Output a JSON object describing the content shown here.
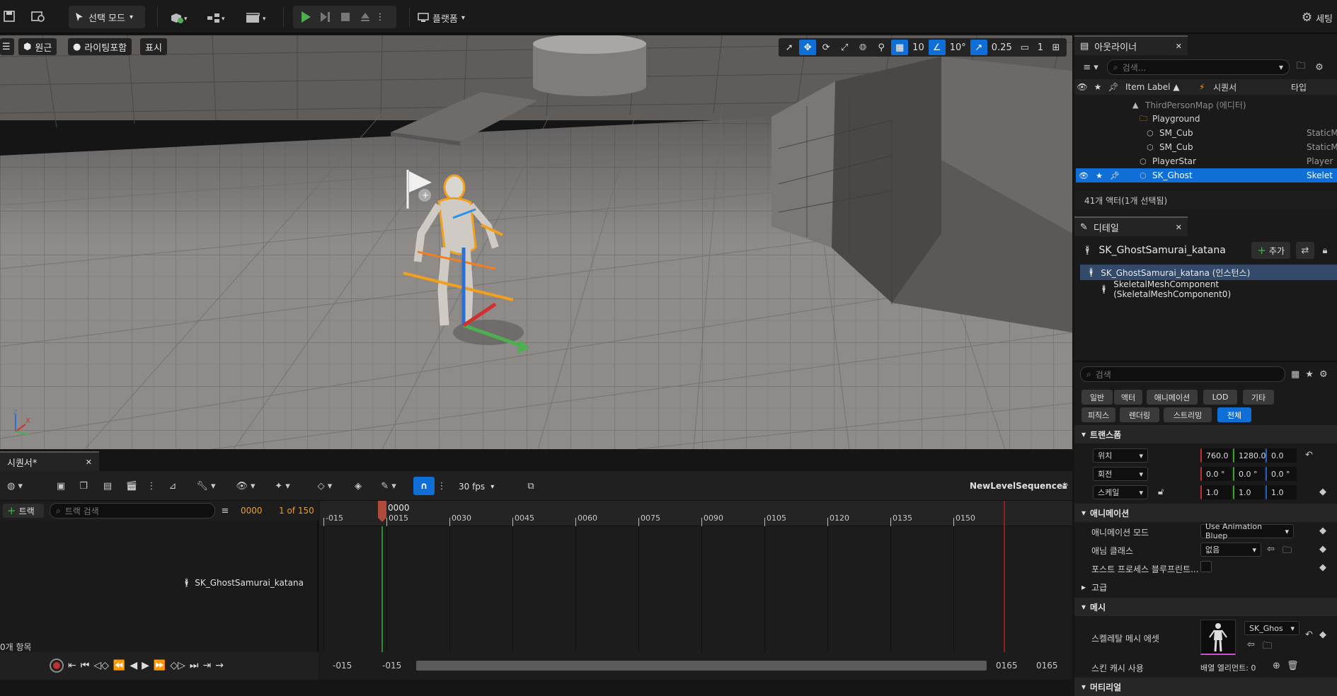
{
  "toolbar": {
    "mode_label": "선택 모드",
    "platform_label": "플랫폼",
    "settings_label": "세팅"
  },
  "viewport": {
    "perspective_label": "원근",
    "lighting_label": "라이팅포함",
    "show_label": "표시",
    "grid_snap": "10",
    "rotation_snap": "10°",
    "scale_snap": "0.25",
    "camera_speed": "1",
    "axis_x": "X",
    "axis_z": "Z"
  },
  "sequencer": {
    "tab_label": "시퀀서*",
    "fps_label": "30 fps",
    "sequence_name": "NewLevelSequence*",
    "add_track_label": "트랙",
    "track_search_placeholder": "트랙 검색",
    "current_frame": "0000",
    "frame_counter": "1 of 150",
    "playhead_label": "0000",
    "ticks": [
      "-015",
      "0015",
      "0030",
      "0045",
      "0060",
      "0075",
      "0090",
      "0105",
      "0120",
      "0135",
      "0150"
    ],
    "track_name": "SK_GhostSamurai_katana",
    "item_count": "0개 항목",
    "range_start_a": "-015",
    "range_start_b": "-015",
    "range_end_a": "0165",
    "range_end_b": "0165"
  },
  "outliner": {
    "tab_label": "아웃라이너",
    "search_placeholder": "검색...",
    "col_label": "Item Label ▲",
    "col_sequencer": "시퀀서",
    "col_type": "타입",
    "rows": [
      {
        "label": "ThirdPersonMap (에디터)",
        "type": "",
        "indent": 0,
        "selected": false,
        "dim": true
      },
      {
        "label": "Playground",
        "type": "",
        "indent": 1,
        "selected": false,
        "dim": false
      },
      {
        "label": "SM_Cub",
        "type": "StaticM",
        "indent": 2,
        "selected": false,
        "dim": false
      },
      {
        "label": "SM_Cub",
        "type": "StaticM",
        "indent": 2,
        "selected": false,
        "dim": false
      },
      {
        "label": "PlayerStar",
        "type": "Player",
        "indent": 1,
        "selected": false,
        "dim": false
      },
      {
        "label": "SK_Ghost",
        "type": "Skelet",
        "indent": 1,
        "selected": true,
        "dim": false
      }
    ],
    "footer": "41개 액터(1개 선택됨)"
  },
  "details": {
    "tab_label": "디테일",
    "actor_name": "SK_GhostSamurai_katana",
    "add_label": "추가",
    "instance_label": "SK_GhostSamurai_katana (인스턴스)",
    "component_label": "SkeletalMeshComponent (SkeletalMeshComponent0)",
    "search_placeholder": "검색",
    "filters_row1": [
      "일반",
      "액터",
      "애니메이션",
      "LOD",
      "기타"
    ],
    "filters_row2": [
      "피직스",
      "렌더링",
      "스트리밍",
      "전체"
    ],
    "active_filter": "전체",
    "transform_section": "트랜스폼",
    "location_label": "위치",
    "location": [
      "760.0",
      "1280.0",
      "0.0"
    ],
    "rotation_label": "회전",
    "rotation": [
      "0.0 °",
      "0.0 °",
      "0.0 °"
    ],
    "scale_label": "스케일",
    "scale": [
      "1.0",
      "1.0",
      "1.0"
    ],
    "animation_section": "애니메이션",
    "anim_mode_label": "애니메이션 모드",
    "anim_mode_value": "Use Animation Bluep",
    "anim_class_label": "애님 클래스",
    "anim_class_value": "없음",
    "post_process_label": "포스트 프로세스 블루프린트...",
    "advanced_label": "고급",
    "mesh_section": "메시",
    "skeletal_mesh_label": "스켈레탈 메시 에셋",
    "skeletal_mesh_value": "SK_Ghos",
    "skin_cache_label": "스킨 캐시 사용",
    "skin_cache_value": "배열 엘리먼트: 0",
    "material_section": "머티리얼"
  },
  "colors": {
    "accent": "#0f6fd6",
    "play_green": "#4caf50",
    "playhead": "#b04a3a",
    "orange_text": "#f0a020"
  }
}
